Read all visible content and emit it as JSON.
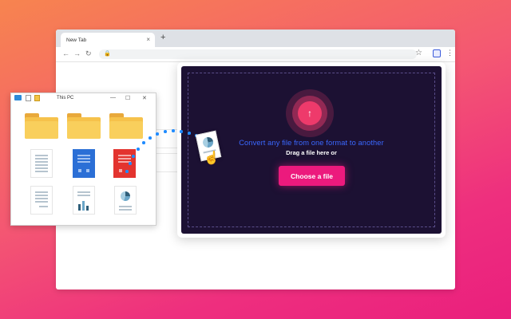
{
  "browser": {
    "tab_title": "New Tab",
    "tab_close": "×",
    "new_tab": "+",
    "nav_back": "←",
    "nav_forward": "→",
    "nav_reload": "↻",
    "lock": "🔒",
    "star": "☆",
    "menu": "⋮"
  },
  "explorer": {
    "title": "This PC",
    "minimize": "—",
    "maximize": "☐",
    "close": "✕"
  },
  "converter": {
    "headline": "Convert any file from one format to another",
    "subtext": "Drag a file here or",
    "button_label": "Choose a file",
    "upload_glyph": "↑"
  },
  "colors": {
    "accent": "#ec1a7d",
    "panel_bg": "#1c1133",
    "headline_blue": "#3a68ff",
    "drag_dots": "#1f8bff"
  }
}
